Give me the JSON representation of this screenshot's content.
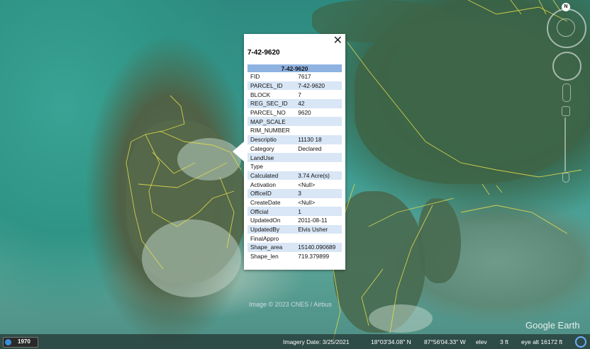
{
  "popup": {
    "title": "7-42-9620",
    "header": "7-42-9620",
    "close_glyph": "✕",
    "rows": [
      {
        "key": "FID",
        "value": "7617"
      },
      {
        "key": "PARCEL_ID",
        "value": "7-42-9620"
      },
      {
        "key": "BLOCK",
        "value": "7"
      },
      {
        "key": "REG_SEC_ID",
        "value": "42"
      },
      {
        "key": "PARCEL_NO",
        "value": "9620"
      },
      {
        "key": "MAP_SCALE",
        "value": ""
      },
      {
        "key": "RIM_NUMBER",
        "value": ""
      },
      {
        "key": "Descriptio",
        "value": "11130 18"
      },
      {
        "key": "Category",
        "value": "Declared"
      },
      {
        "key": "LandUse",
        "value": ""
      },
      {
        "key": "Type",
        "value": ""
      },
      {
        "key": "Calculated",
        "value": "3.74 Acre(s)"
      },
      {
        "key": "Activation",
        "value": "<Null>"
      },
      {
        "key": "OfficeID",
        "value": "3"
      },
      {
        "key": "CreateDate",
        "value": "<Null>"
      },
      {
        "key": "Official",
        "value": "1"
      },
      {
        "key": "UpdatedOn",
        "value": "2011-08-11"
      },
      {
        "key": "UpdatedBy",
        "value": "Elvis Usher"
      },
      {
        "key": "FinalAppro",
        "value": ""
      },
      {
        "key": "Shape_area",
        "value": "15140.090689"
      },
      {
        "key": "Shape_len",
        "value": "719.379899"
      }
    ]
  },
  "nav": {
    "north_label": "N"
  },
  "map": {
    "credit": "Image © 2023 CNES / Airbus",
    "brand": "Google Earth"
  },
  "statusbar": {
    "year": "1970",
    "imagery_date": "Imagery Date: 3/25/2021",
    "latitude": "18°03'34.08\" N",
    "longitude": "87°56'04.33\" W",
    "elev_label": "elev",
    "elev_value": "3 ft",
    "eye_alt": "eye alt  16172 ft"
  },
  "colors": {
    "popup_header": "#8fb3e0",
    "popup_alt_row": "#d8e6f5",
    "parcel_lines": "#e6e04a"
  }
}
